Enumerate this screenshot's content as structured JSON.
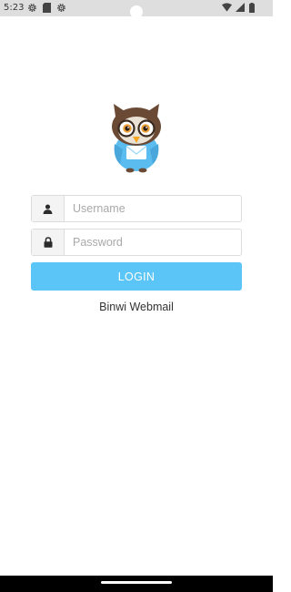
{
  "status_bar": {
    "time": "5:23",
    "left_icons": [
      "settings-gear-icon",
      "sim-card-icon",
      "settings-gear-icon"
    ],
    "right_icons": [
      "wifi-icon",
      "cellular-signal-icon",
      "battery-icon"
    ]
  },
  "logo": {
    "icon": "owl-mail-mascot-icon"
  },
  "login_form": {
    "username": {
      "icon": "user-icon",
      "placeholder": "Username",
      "value": ""
    },
    "password": {
      "icon": "lock-icon",
      "placeholder": "Password",
      "value": ""
    },
    "login_label": "LOGIN"
  },
  "app_name": "Binwi Webmail",
  "colors": {
    "accent": "#5bc5f7",
    "status_bar_bg": "#dedede",
    "nav_bar_bg": "#000000",
    "owl_body": "#5bbcf0",
    "owl_head": "#6b4a35",
    "owl_beak": "#f5a623"
  }
}
